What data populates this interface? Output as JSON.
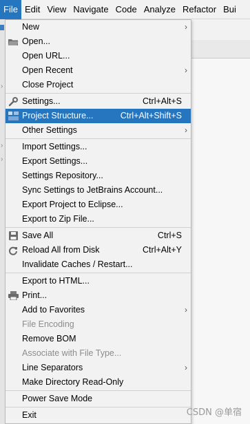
{
  "menubar": {
    "items": [
      "File",
      "Edit",
      "View",
      "Navigate",
      "Code",
      "Analyze",
      "Refactor",
      "Bui"
    ]
  },
  "menu": {
    "new": {
      "label": "New"
    },
    "open": {
      "label": "Open..."
    },
    "open_url": {
      "label": "Open URL..."
    },
    "open_recent": {
      "label": "Open Recent"
    },
    "close_project": {
      "label": "Close Project"
    },
    "settings": {
      "label": "Settings...",
      "shortcut": "Ctrl+Alt+S"
    },
    "project_structure": {
      "label": "Project Structure...",
      "shortcut": "Ctrl+Alt+Shift+S"
    },
    "other_settings": {
      "label": "Other Settings"
    },
    "import_settings": {
      "label": "Import Settings..."
    },
    "export_settings": {
      "label": "Export Settings..."
    },
    "settings_repository": {
      "label": "Settings Repository..."
    },
    "sync_settings": {
      "label": "Sync Settings to JetBrains Account..."
    },
    "export_eclipse": {
      "label": "Export Project to Eclipse..."
    },
    "export_zip": {
      "label": "Export to Zip File..."
    },
    "save_all": {
      "label": "Save All",
      "shortcut": "Ctrl+S"
    },
    "reload_all": {
      "label": "Reload All from Disk",
      "shortcut": "Ctrl+Alt+Y"
    },
    "invalidate_caches": {
      "label": "Invalidate Caches / Restart..."
    },
    "export_html": {
      "label": "Export to HTML..."
    },
    "print": {
      "label": "Print..."
    },
    "add_favorites": {
      "label": "Add to Favorites"
    },
    "file_encoding": {
      "label": "File Encoding"
    },
    "remove_bom": {
      "label": "Remove BOM"
    },
    "associate_file_type": {
      "label": "Associate with File Type..."
    },
    "line_separators": {
      "label": "Line Separators"
    },
    "make_read_only": {
      "label": "Make Directory Read-Only"
    },
    "power_save": {
      "label": "Power Save Mode"
    },
    "exit": {
      "label": "Exit"
    }
  },
  "watermark": "CSDN @单宿",
  "colors": {
    "accent": "#2675bf",
    "background": "#f2f2f2",
    "disabled": "#8c8c8c"
  }
}
